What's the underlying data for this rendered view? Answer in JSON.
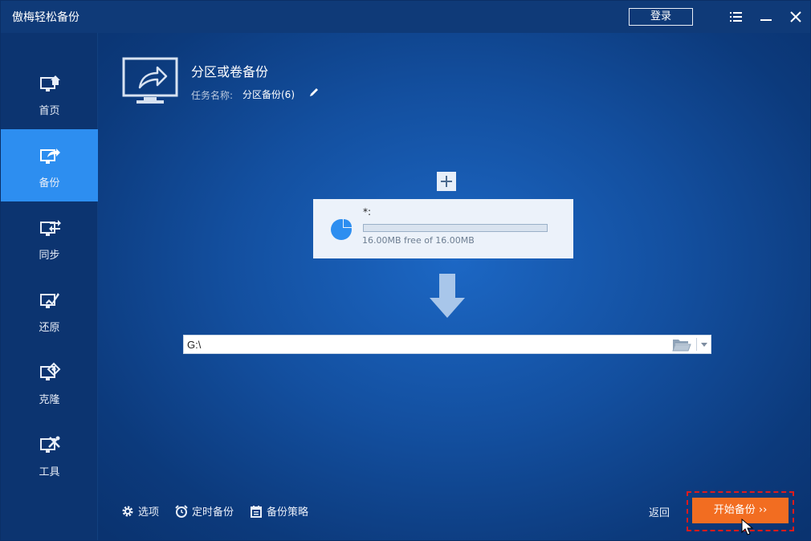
{
  "app": {
    "title": "傲梅轻松备份",
    "login_label": "登录",
    "icons": {
      "menu": "menu-icon",
      "minimize": "minimize-icon",
      "close": "close-icon"
    }
  },
  "sidebar": {
    "items": [
      {
        "label": "首页",
        "icon": "home-icon"
      },
      {
        "label": "备份",
        "icon": "backup-icon",
        "active": true
      },
      {
        "label": "同步",
        "icon": "sync-icon"
      },
      {
        "label": "还原",
        "icon": "restore-icon"
      },
      {
        "label": "克隆",
        "icon": "clone-icon"
      },
      {
        "label": "工具",
        "icon": "tools-icon"
      }
    ]
  },
  "main": {
    "title": "分区或卷备份",
    "task_label": "任务名称:",
    "task_value": "分区备份(6)",
    "source": {
      "name": "*:",
      "size_text": "16.00MB free of 16.00MB",
      "used_fraction": 0.0
    },
    "destination": {
      "value": "G:\\"
    }
  },
  "bottom": {
    "options_label": "选项",
    "schedule_label": "定时备份",
    "scheme_label": "备份策略",
    "back_label": "返回",
    "start_label": "开始备份 ››"
  },
  "colors": {
    "accent": "#2d8ef0",
    "start": "#f26d21",
    "highlight": "#e01b1b"
  }
}
